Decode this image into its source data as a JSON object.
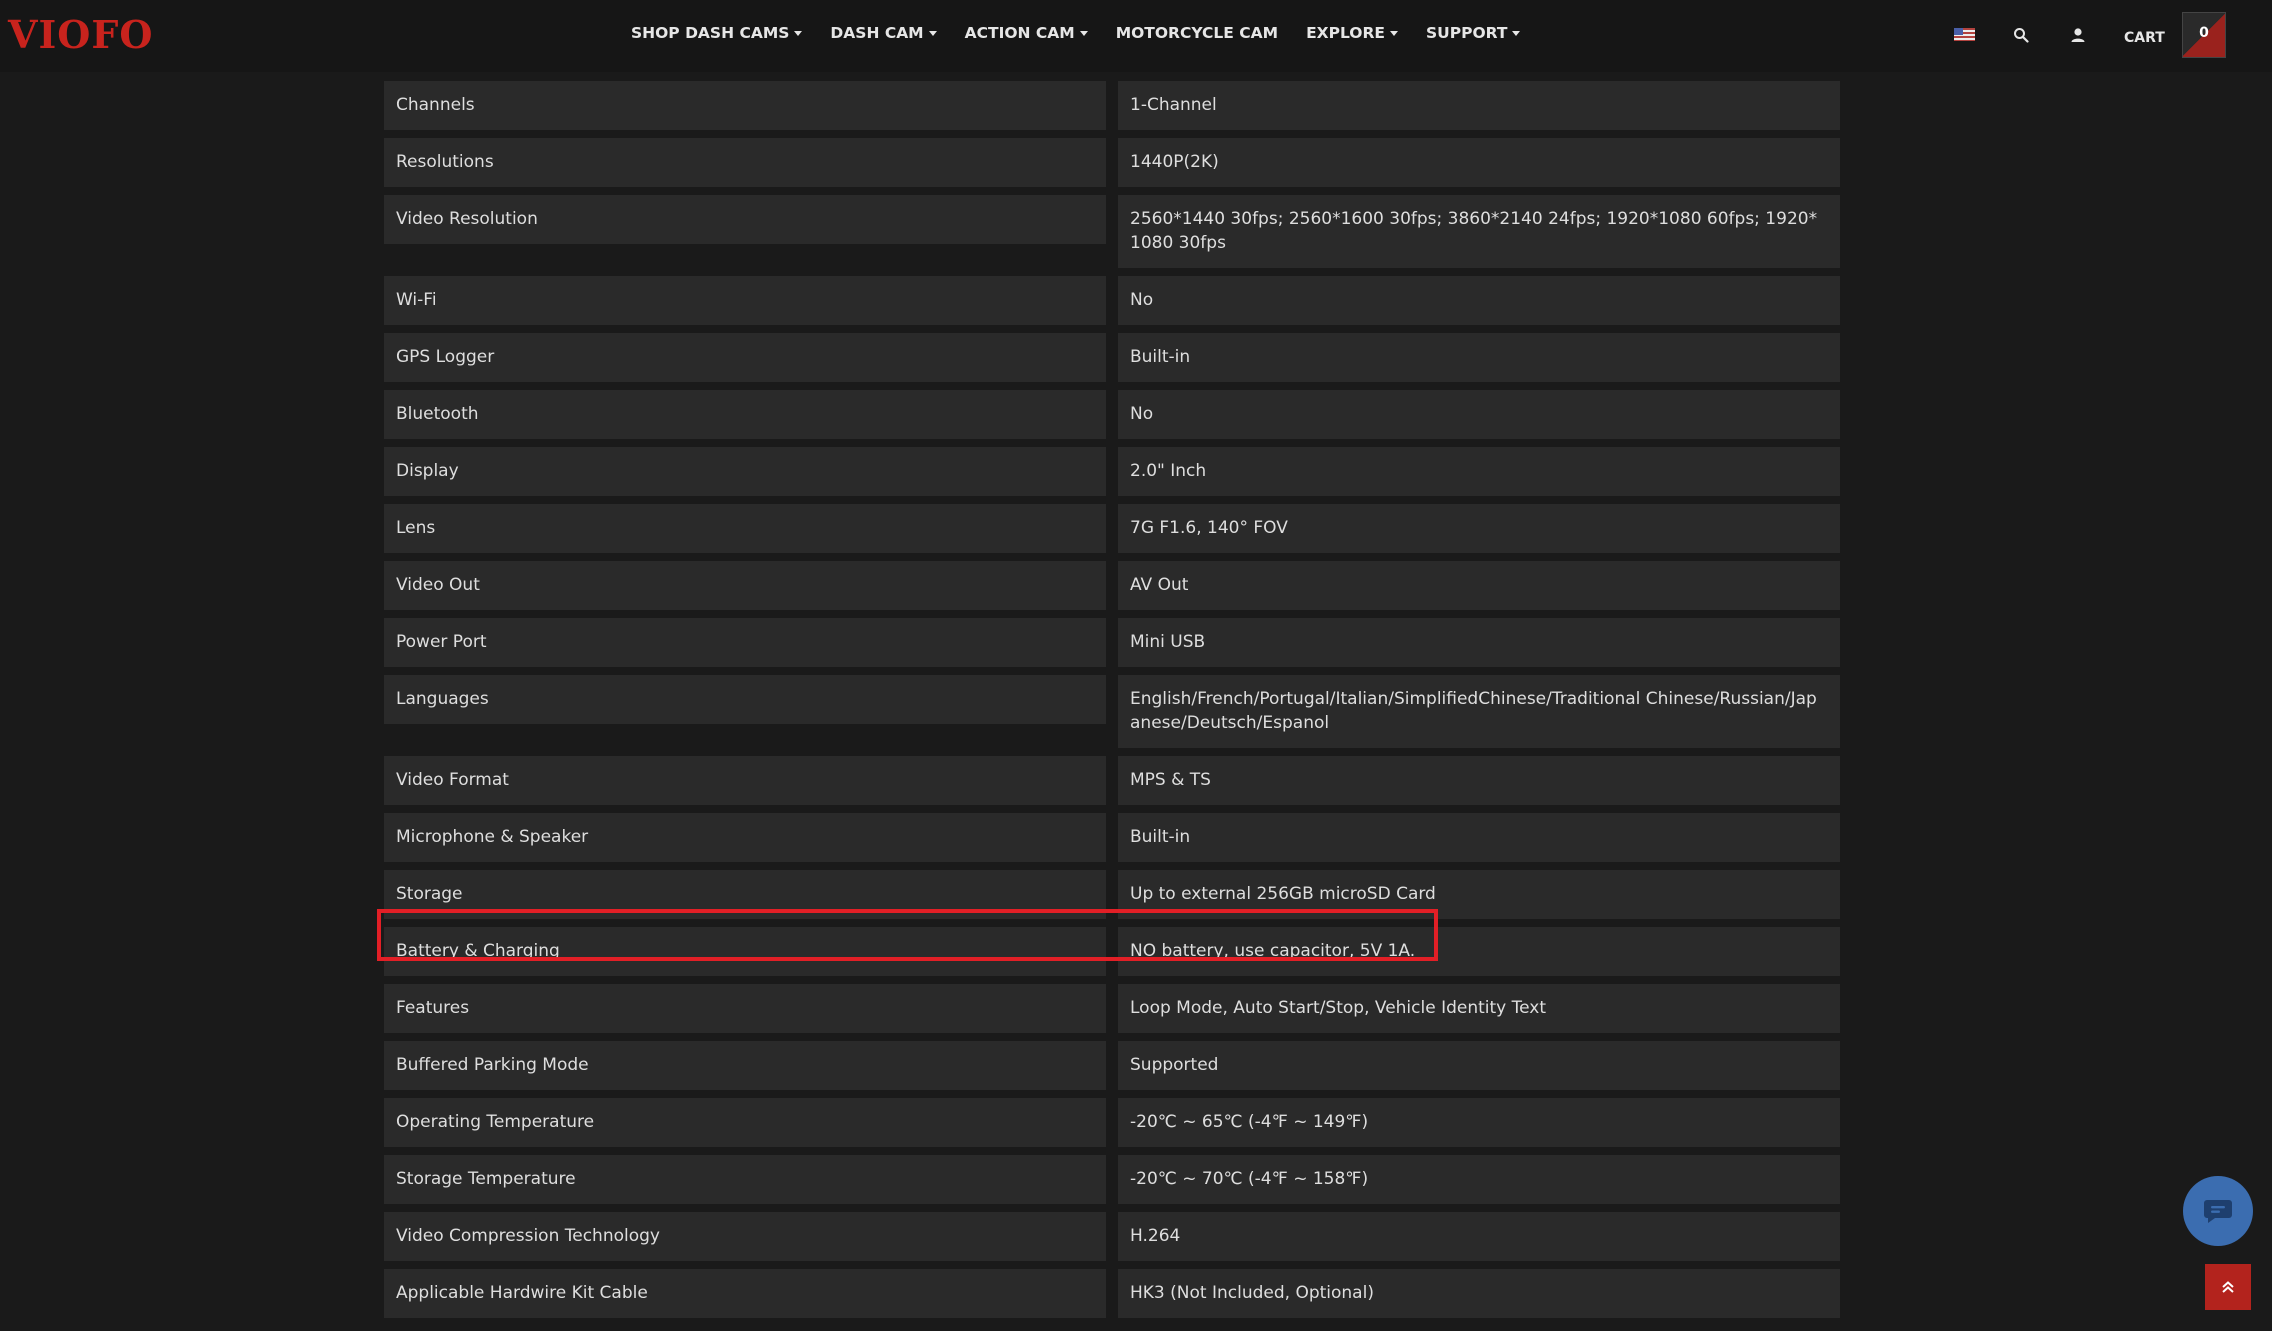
{
  "header": {
    "logo": "VIOFO",
    "nav": [
      {
        "label": "SHOP DASH CAMS",
        "dropdown": true
      },
      {
        "label": "DASH CAM",
        "dropdown": true
      },
      {
        "label": "ACTION CAM",
        "dropdown": true
      },
      {
        "label": "MOTORCYCLE CAM",
        "dropdown": false
      },
      {
        "label": "EXPLORE",
        "dropdown": true
      },
      {
        "label": "SUPPORT",
        "dropdown": true
      }
    ],
    "cart_label": "CART",
    "cart_count": "0"
  },
  "specs": [
    {
      "label": "Channels",
      "value": "1-Channel"
    },
    {
      "label": "Resolutions",
      "value": "1440P(2K)"
    },
    {
      "label": "Video Resolution",
      "value": "2560*1440 30fps; 2560*1600 30fps; 3860*2140 24fps; 1920*1080 60fps; 1920*1080 30fps"
    },
    {
      "label": "Wi-Fi",
      "value": "No"
    },
    {
      "label": "GPS Logger",
      "value": "Built-in"
    },
    {
      "label": "Bluetooth",
      "value": "No"
    },
    {
      "label": "Display",
      "value": "2.0\" Inch"
    },
    {
      "label": "Lens",
      "value": "7G F1.6, 140° FOV"
    },
    {
      "label": "Video Out",
      "value": "AV Out"
    },
    {
      "label": "Power Port",
      "value": "Mini USB"
    },
    {
      "label": "Languages",
      "value": "English/French/Portugal/Italian/SimplifiedChinese/Traditional Chinese/Russian/Japanese/Deutsch/Espanol"
    },
    {
      "label": "Video Format",
      "value": "MPS & TS"
    },
    {
      "label": "Microphone & Speaker",
      "value": "Built-in"
    },
    {
      "label": "Storage",
      "value": "Up to external 256GB microSD Card"
    },
    {
      "label": "Battery & Charging",
      "value": "NO battery, use capacitor, 5V 1A."
    },
    {
      "label": "Features",
      "value": "Loop Mode, Auto Start/Stop, Vehicle Identity Text"
    },
    {
      "label": "Buffered Parking Mode",
      "value": "Supported"
    },
    {
      "label": "Operating Temperature",
      "value": "-20℃ ~ 65℃ (-4℉ ~ 149℉)"
    },
    {
      "label": "Storage Temperature",
      "value": "-20℃ ~ 70℃ (-4℉ ~ 158℉)"
    },
    {
      "label": "Video Compression Technology",
      "value": "H.264"
    },
    {
      "label": "Applicable Hardwire Kit Cable",
      "value": "HK3 (Not Included, Optional)"
    }
  ],
  "icons": {
    "flag": "us-flag-icon",
    "search": "search-icon",
    "user": "user-icon",
    "chat": "chat-icon",
    "scroll_top": "double-chevron-up-icon"
  },
  "colors": {
    "brand": "#c8231d",
    "highlight": "#e21f26",
    "chat": "#3b6db0"
  }
}
